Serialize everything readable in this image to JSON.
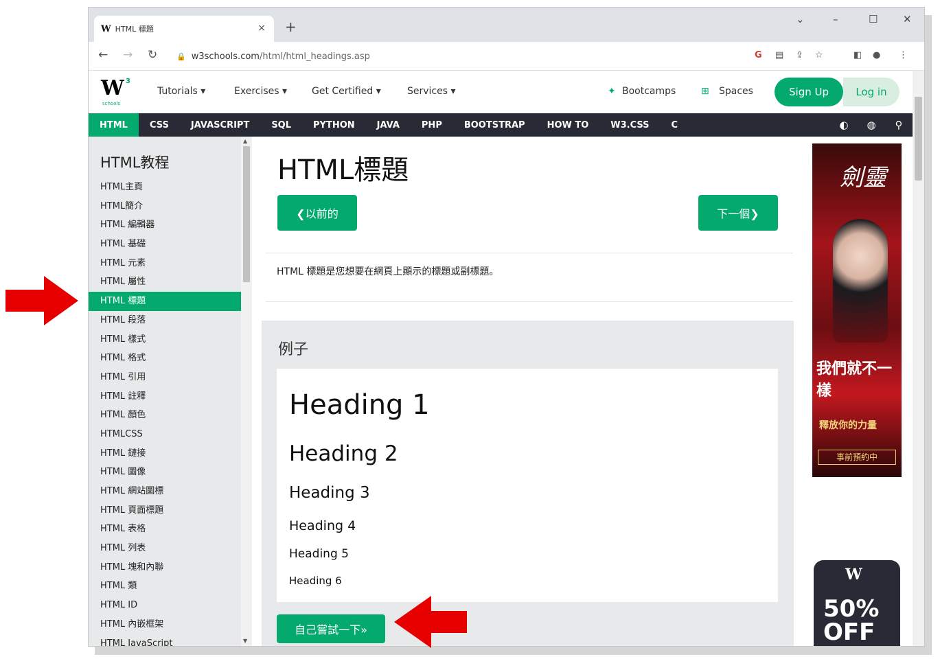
{
  "browser": {
    "tab_title": "HTML 標題",
    "tab_favicon": "W",
    "new_tab": "+",
    "close_tab": "×",
    "url_host": "w3schools.com",
    "url_path": "/html/html_headings.asp",
    "window_controls": [
      "⌄",
      "–",
      "☐",
      "✕"
    ]
  },
  "site": {
    "logo_main": "W",
    "logo_sup": "3",
    "logo_sub": "schools",
    "topnav": [
      "Tutorials ▾",
      "Exercises ▾",
      "Get Certified ▾",
      "Services ▾"
    ],
    "bootcamps": "Bootcamps",
    "spaces": "Spaces",
    "signup": "Sign Up",
    "login": "Log in"
  },
  "topicnav": [
    "HTML",
    "CSS",
    "JAVASCRIPT",
    "SQL",
    "PYTHON",
    "JAVA",
    "PHP",
    "BOOTSTRAP",
    "HOW TO",
    "W3.CSS",
    "C"
  ],
  "sidebar": {
    "title": "HTML教程",
    "links": [
      "HTML主頁",
      "HTML簡介",
      "HTML 編輯器",
      "HTML 基礎",
      "HTML 元素",
      "HTML 屬性",
      "HTML 標題",
      "HTML 段落",
      "HTML 樣式",
      "HTML 格式",
      "HTML 引用",
      "HTML 註釋",
      "HTML 顏色",
      "HTMLCSS",
      "HTML 鏈接",
      "HTML 圖像",
      "HTML 網站圖標",
      "HTML 頁面標題",
      "HTML 表格",
      "HTML 列表",
      "HTML 塊和內聯",
      "HTML 類",
      "HTML ID",
      "HTML 內嵌框架",
      "HTML JavaScript"
    ],
    "active_index": 6
  },
  "main": {
    "title": "HTML標題",
    "prev": "❮以前的",
    "next": "下一個❯",
    "intro": "HTML 標題是您想要在網頁上顯示的標題或副標題。",
    "example_title": "例子",
    "headings": [
      "Heading 1",
      "Heading 2",
      "Heading 3",
      "Heading 4",
      "Heading 5",
      "Heading 6"
    ],
    "tryit": "自己嘗試一下»"
  },
  "ads": {
    "ad1_title": "劍靈",
    "ad1_slogan": "我們就不一樣",
    "ad1_sub": "釋放你的力量",
    "ad1_btn": "事前預約中",
    "ad2_logo": "W",
    "ad2_pct": "50%",
    "ad2_off": "OFF"
  },
  "colors": {
    "accent": "#04aa6d",
    "topnav_bg": "#282a35",
    "sidebar_bg": "#e7e9eb",
    "arrow": "#e60000"
  }
}
